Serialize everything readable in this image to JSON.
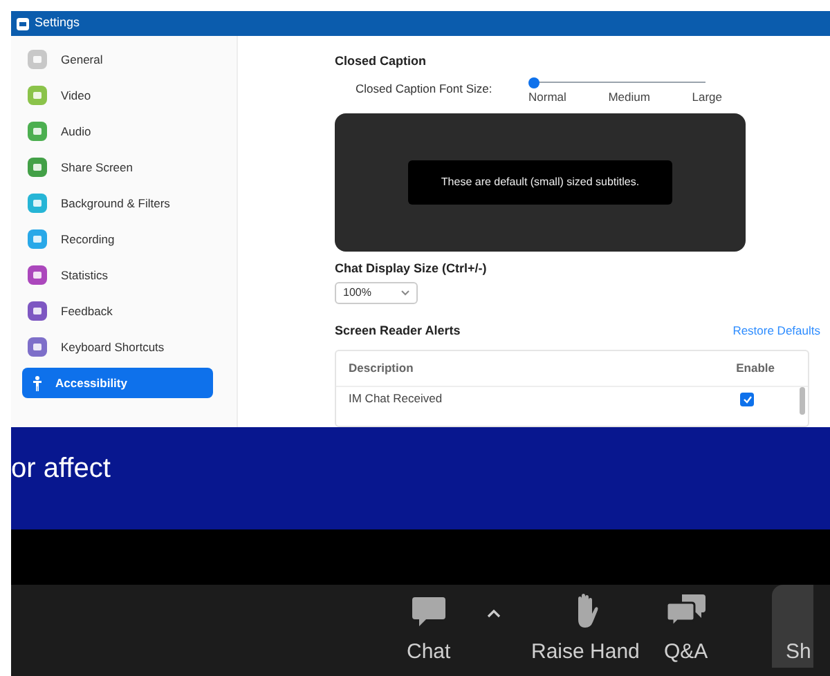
{
  "window": {
    "title": "Settings"
  },
  "sidebar": {
    "items": [
      {
        "label": "General",
        "selected": false,
        "color": "#c8c8c8"
      },
      {
        "label": "Video",
        "selected": false,
        "color": "#8bc34a"
      },
      {
        "label": "Audio",
        "selected": false,
        "color": "#4caf50"
      },
      {
        "label": "Share Screen",
        "selected": false,
        "color": "#43a047"
      },
      {
        "label": "Background & Filters",
        "selected": false,
        "color": "#26b5d6"
      },
      {
        "label": "Recording",
        "selected": false,
        "color": "#29a8e8"
      },
      {
        "label": "Statistics",
        "selected": false,
        "color": "#ab47bc"
      },
      {
        "label": "Feedback",
        "selected": false,
        "color": "#7e57c2"
      },
      {
        "label": "Keyboard Shortcuts",
        "selected": false,
        "color": "#7e6fc9"
      },
      {
        "label": "Accessibility",
        "selected": true,
        "color": "#ffffff"
      }
    ]
  },
  "closed_caption": {
    "heading": "Closed Caption",
    "font_size_label": "Closed Caption Font Size:",
    "level": 0,
    "stops": [
      "Normal",
      "Medium",
      "Large"
    ],
    "preview_text": "These are default (small) sized subtitles."
  },
  "chat_display": {
    "heading": "Chat Display Size (Ctrl+/-)",
    "value": "100%"
  },
  "screen_reader": {
    "heading": "Screen Reader Alerts",
    "restore": "Restore Defaults",
    "columns": [
      "Description",
      "Enable"
    ],
    "rows": [
      {
        "description": "IM Chat Received",
        "enabled": true
      }
    ]
  },
  "slide": {
    "text": "or affect"
  },
  "toolbar": {
    "buttons": [
      {
        "kind": "chat",
        "label": "Chat"
      },
      {
        "kind": "hand",
        "label": "Raise Hand"
      },
      {
        "kind": "qa",
        "label": "Q&A"
      },
      {
        "kind": "share",
        "label": "Sh"
      }
    ]
  }
}
